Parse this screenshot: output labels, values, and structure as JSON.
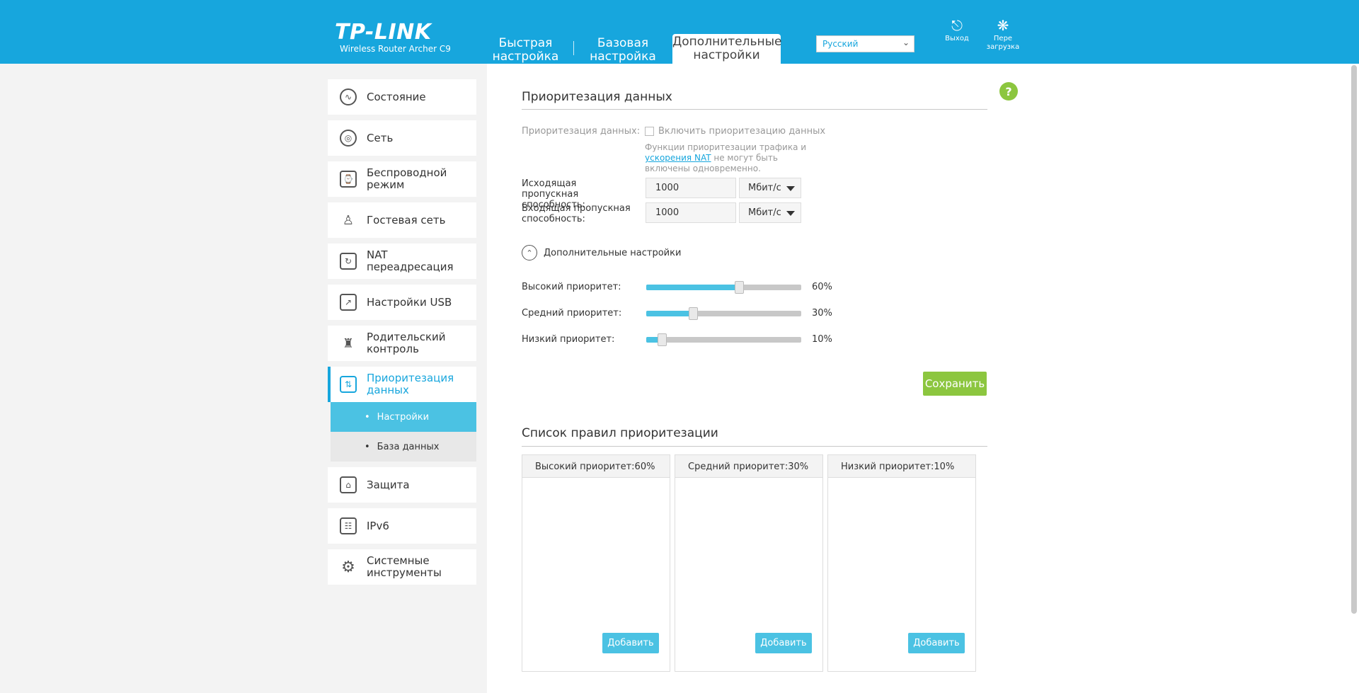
{
  "header": {
    "logo": "TP-LINK",
    "model": "Wireless Router Archer C9",
    "tabs": [
      {
        "label": "Быстрая настройка"
      },
      {
        "label": "Базовая настройка"
      },
      {
        "label": "Дополнительные настройки"
      }
    ],
    "language": "Русский",
    "logout_label": "Выход",
    "reboot_label": "Пере загрузка",
    "accent_color": "#17a6dd"
  },
  "sidebar": {
    "items": [
      {
        "label": "Состояние",
        "icon": "status-icon"
      },
      {
        "label": "Сеть",
        "icon": "globe-icon"
      },
      {
        "label": "Беспроводной режим",
        "icon": "wireless-icon"
      },
      {
        "label": "Гостевая сеть",
        "icon": "guests-icon"
      },
      {
        "label": "NAT переадресация",
        "icon": "nat-icon"
      },
      {
        "label": "Настройки USB",
        "icon": "usb-icon"
      },
      {
        "label": "Родительский контроль",
        "icon": "parental-icon"
      },
      {
        "label": "Приоритезация данных",
        "icon": "qos-icon"
      },
      {
        "label": "Защита",
        "icon": "lock-icon"
      },
      {
        "label": "IPv6",
        "icon": "ipv6-icon"
      },
      {
        "label": "Системные инструменты",
        "icon": "gear-icon"
      }
    ],
    "sub_items": [
      {
        "label": "Настройки"
      },
      {
        "label": "База данных"
      }
    ]
  },
  "qos": {
    "title": "Приоритезация данных",
    "enable_label": "Приоритезация данных:",
    "enable_checkbox_label": "Включить приоритезацию данных",
    "note_before": "Функции приоритезации трафика и",
    "note_link": "ускорения NAT",
    "note_after": " не могут быть включены одновременно.",
    "upload_label": "Исходящая пропускная способность:",
    "upload_value": "1000",
    "upload_unit": "Мбит/с",
    "download_label": "Входящая пропускная способность:",
    "download_value": "1000",
    "download_unit": "Мбит/с",
    "advanced_label": "Дополнительные настройки",
    "priorities": [
      {
        "label": "Высокий приоритет:",
        "value": 60,
        "value_text": "60%"
      },
      {
        "label": "Средний приоритет:",
        "value": 30,
        "value_text": "30%"
      },
      {
        "label": "Низкий приоритет:",
        "value": 10,
        "value_text": "10%"
      }
    ],
    "save_label": "Сохранить"
  },
  "rules": {
    "title": "Список правил приоритезации",
    "columns": [
      {
        "header": "Высокий приоритет:60%",
        "add_label": "Добавить"
      },
      {
        "header": "Средний приоритет:30%",
        "add_label": "Добавить"
      },
      {
        "header": "Низкий приоритет:10%",
        "add_label": "Добавить"
      }
    ]
  }
}
